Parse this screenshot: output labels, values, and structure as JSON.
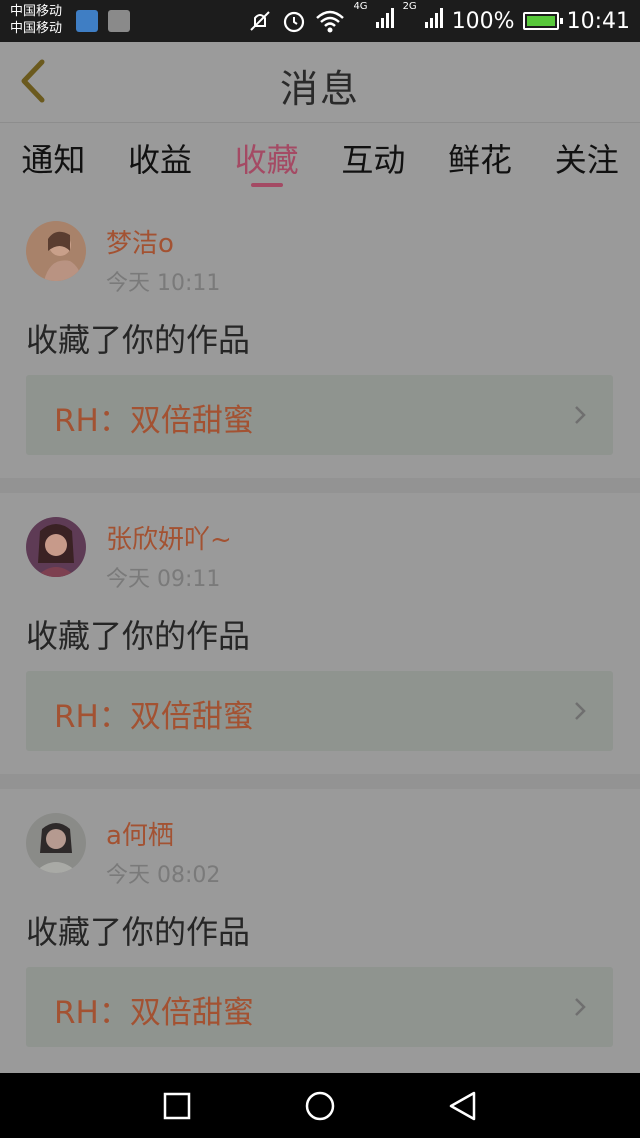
{
  "status_bar": {
    "carrier_1": "中国移动",
    "carrier_2": "中国移动",
    "network_1": "4G",
    "network_2": "2G",
    "battery": "100%",
    "time": "10:41",
    "icons": [
      "app-notification-icon",
      "image-notification-icon",
      "mute-icon",
      "alarm-icon",
      "wifi-icon",
      "signal-icon",
      "battery-charging-icon"
    ]
  },
  "header": {
    "title": "消息",
    "back_icon": "chevron-left-icon",
    "back_color": "#6b5a1e"
  },
  "tabs": [
    {
      "label": "通知",
      "active": false
    },
    {
      "label": "收益",
      "active": false
    },
    {
      "label": "收藏",
      "active": true
    },
    {
      "label": "互动",
      "active": false
    },
    {
      "label": "鲜花",
      "active": false
    },
    {
      "label": "关注",
      "active": false
    }
  ],
  "accent_color": "#a44a64",
  "messages": [
    {
      "username": "梦洁o",
      "time": "今天 10:11",
      "action": "收藏了你的作品",
      "work_title": "RH：双倍甜蜜"
    },
    {
      "username": "张欣妍吖~",
      "time": "今天 09:11",
      "action": "收藏了你的作品",
      "work_title": "RH：双倍甜蜜"
    },
    {
      "username": "a何栖",
      "time": "今天 08:02",
      "action": "收藏了你的作品",
      "work_title": "RH：双倍甜蜜"
    }
  ],
  "nav_bar": {
    "icons": [
      "recent-apps-icon",
      "home-icon",
      "back-icon"
    ]
  }
}
